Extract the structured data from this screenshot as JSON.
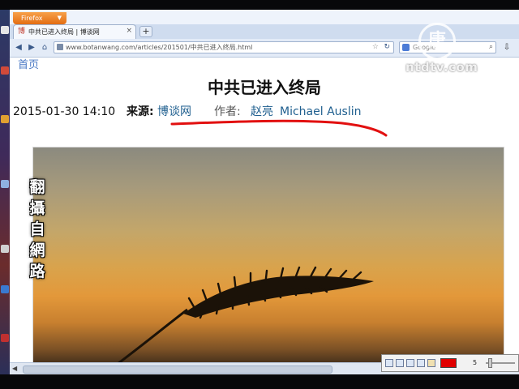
{
  "browser": {
    "app_button": "Firefox",
    "tab_title": "中共已进入终局 | 博谈网",
    "url": "www.botanwang.com/articles/201501/中共已进入终局.html",
    "search_placeholder": "Google"
  },
  "page": {
    "home_link": "首页",
    "title": "中共已进入终局",
    "date": "2015-01-30 14:10",
    "source_label": "来源:",
    "source": "博谈网",
    "author_label": "作者:",
    "author_1": "赵亮",
    "author_2": "Michael Auslin"
  },
  "overlay": {
    "caption": "翻攝自網路",
    "logo_char": "唐",
    "logo_text": "ntdtv.com"
  },
  "paint_toolbar": {
    "brush_color": "#e00000",
    "brush_size": "5"
  }
}
